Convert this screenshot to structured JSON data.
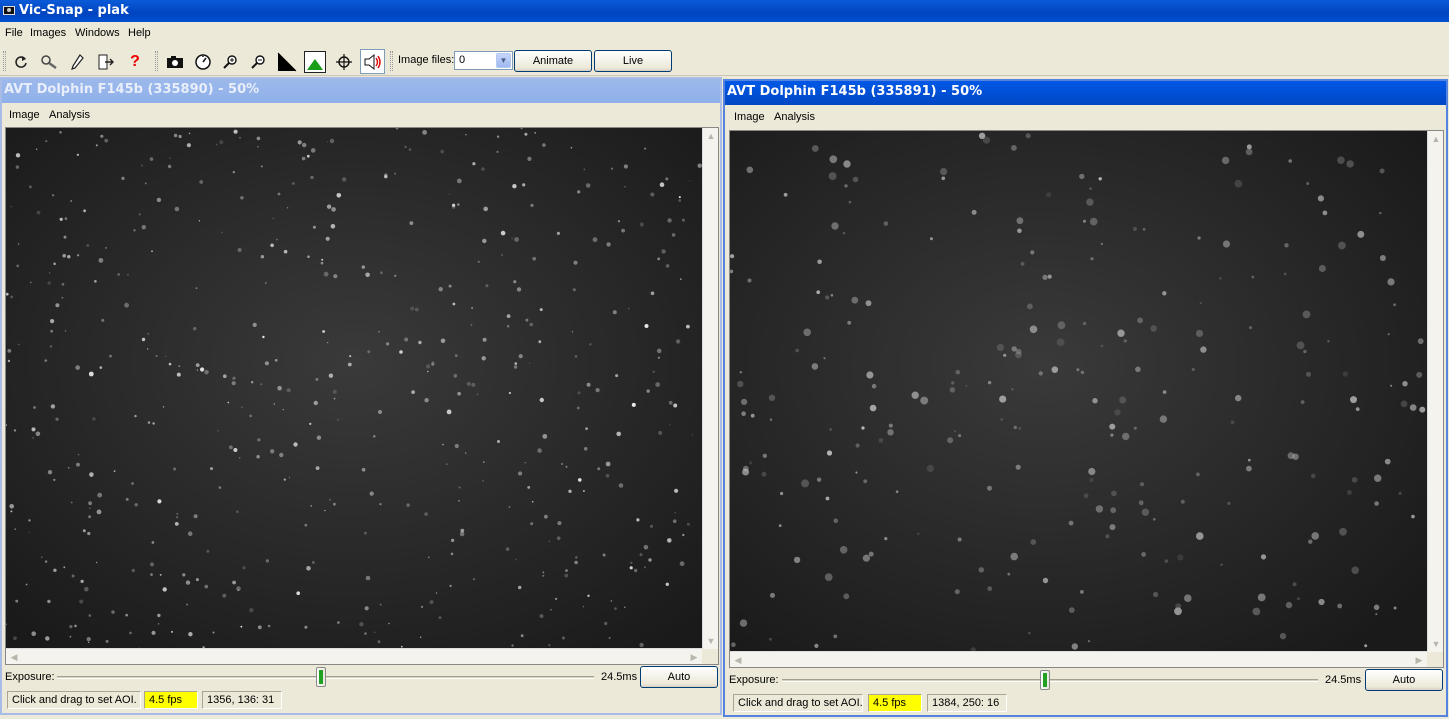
{
  "app": {
    "title": "Vic-Snap - plak"
  },
  "menu": [
    "File",
    "Images",
    "Windows",
    "Help"
  ],
  "toolbar": {
    "icons": [
      "refresh-icon",
      "zoom-tool-icon",
      "pencil-icon",
      "exit-door-icon",
      "help-icon",
      "camera-icon",
      "timer-icon",
      "zoom-in-icon",
      "zoom-out-icon",
      "gamma-icon",
      "histogram-icon",
      "crosshair-icon",
      "speaker-icon"
    ],
    "image_files_label": "Image files:",
    "image_files_value": "0",
    "animate_label": "Animate",
    "live_label": "Live"
  },
  "windows": [
    {
      "title": "AVT Dolphin F145b (335890) - 50%",
      "menu": [
        "Image",
        "Analysis"
      ],
      "exposure_label": "Exposure:",
      "exposure_value": "24.5ms",
      "exposure_level": 0.49,
      "auto_label": "Auto",
      "status_hint": "Click and drag to set AOI.",
      "fps": "4.5 fps",
      "coords": "1356, 136: 31"
    },
    {
      "title": "AVT Dolphin F145b (335891) - 50%",
      "menu": [
        "Image",
        "Analysis"
      ],
      "exposure_label": "Exposure:",
      "exposure_value": "24.5ms",
      "exposure_level": 0.49,
      "auto_label": "Auto",
      "status_hint": "Click and drag to set AOI.",
      "fps": "4.5 fps",
      "coords": "1384, 250: 16"
    }
  ],
  "colors": {
    "xp_blue": "#0050d0",
    "fps_highlight": "#ffff00",
    "image_bg": "#2a2a2a"
  }
}
